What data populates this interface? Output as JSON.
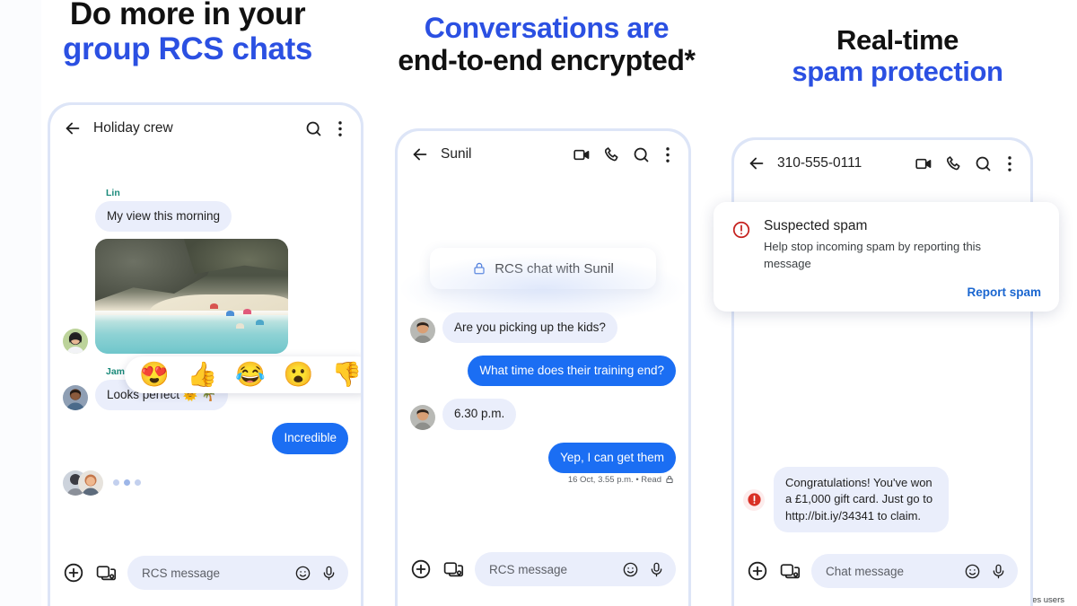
{
  "panels": [
    {
      "headline_dark": "Do more in your",
      "headline_blue": "group RCS chats",
      "chat": {
        "title": "Holiday crew",
        "icons": [
          "back-arrow-icon",
          "search-icon",
          "overflow-menu-icon"
        ],
        "messages": [
          {
            "sender": "Lin",
            "text": "My view this morning",
            "side": "left",
            "type": "text"
          },
          {
            "sender": "Lin",
            "text": "",
            "side": "left",
            "type": "photo"
          },
          {
            "sender": "James",
            "text": "Looks perfect 🌞 🌴",
            "side": "left",
            "type": "text"
          },
          {
            "sender": "",
            "text": "Incredible",
            "side": "right",
            "type": "text"
          }
        ],
        "reactions": [
          "😍",
          "👍",
          "😂",
          "😮",
          "👎"
        ],
        "composer_placeholder": "RCS message"
      }
    },
    {
      "headline_blue": "Conversations are",
      "headline_dark": "end-to-end encrypted*",
      "chat": {
        "title": "Sunil",
        "icons": [
          "back-arrow-icon",
          "video-call-icon",
          "phone-call-icon",
          "search-icon",
          "overflow-menu-icon"
        ],
        "encryption_chip": "RCS chat with Sunil",
        "messages": [
          {
            "text": "Are you picking up the kids?",
            "side": "left"
          },
          {
            "text": "What time does their training end?",
            "side": "right"
          },
          {
            "text": "6.30 p.m.",
            "side": "left"
          },
          {
            "text": "Yep, I can get them",
            "side": "right"
          }
        ],
        "delivery_meta": "16 Oct, 3.55 p.m. • Read",
        "composer_placeholder": "RCS message"
      },
      "footnote": "*Between Google Messages users"
    },
    {
      "headline_dark": "Real-time",
      "headline_blue": "spam protection",
      "chat": {
        "title": "310-555-0111",
        "icons": [
          "back-arrow-icon",
          "video-call-icon",
          "phone-call-icon",
          "search-icon",
          "overflow-menu-icon"
        ],
        "spam_card": {
          "title": "Suspected spam",
          "body": "Help stop incoming spam by reporting this message",
          "action": "Report spam"
        },
        "messages": [
          {
            "text": "Congratulations! You've won a £1,000 gift card. Just go to http://bit.iy/34341 to claim.",
            "side": "left",
            "flagged": true
          }
        ],
        "composer_placeholder": "Chat message"
      }
    }
  ],
  "colors": {
    "accent_blue": "#2b50e2",
    "bubble_blue": "#1b6ef3",
    "bubble_grey": "#eaeefb",
    "sender_teal": "#1a8a7a",
    "link_blue": "#1a66d0",
    "spam_red": "#c5221f",
    "phone_frame": "#dde5f7"
  }
}
